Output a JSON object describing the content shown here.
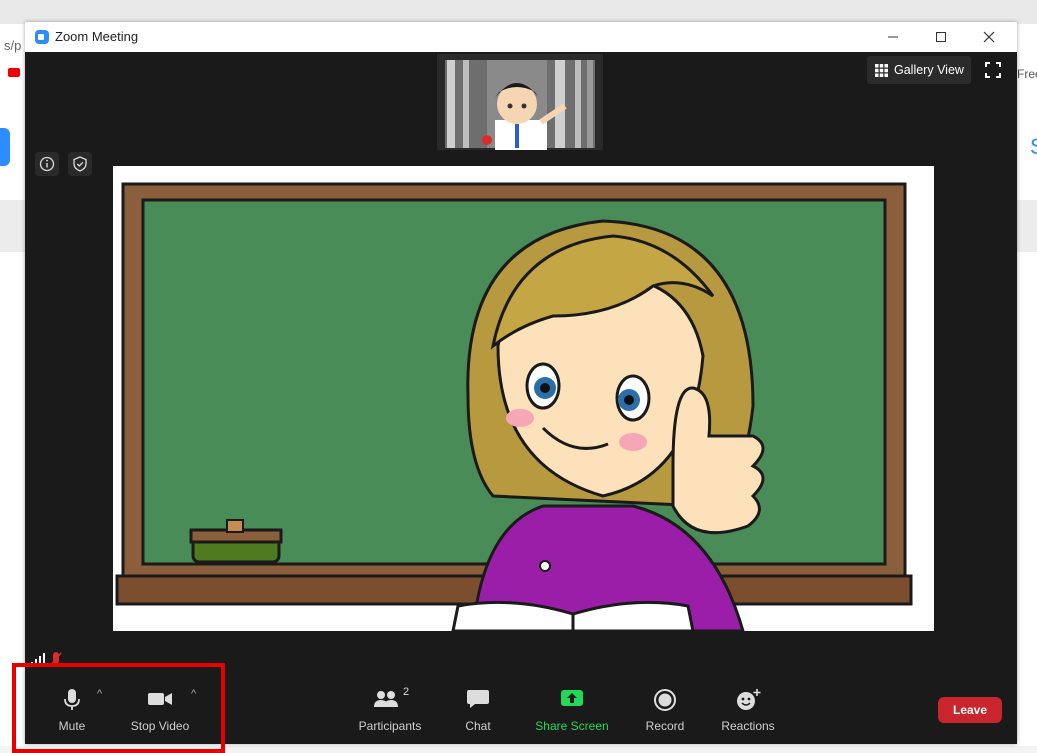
{
  "window": {
    "title": "Zoom Meeting"
  },
  "background": {
    "url_fragment": "s/p",
    "right_text": "Free",
    "right_letter": "S"
  },
  "top_controls": {
    "gallery_view_label": "Gallery View"
  },
  "toolbar": {
    "mute_label": "Mute",
    "stop_video_label": "Stop Video",
    "participants_label": "Participants",
    "participants_count": "2",
    "chat_label": "Chat",
    "share_screen_label": "Share Screen",
    "record_label": "Record",
    "reactions_label": "Reactions",
    "leave_label": "Leave"
  },
  "colors": {
    "accent": "#2d8cff",
    "share_green": "#23d959",
    "leave_red": "#c8252c",
    "highlight_red": "#e80000",
    "chalkboard": "#4a8c58"
  },
  "icons": [
    "zoom-app-icon",
    "minimize-icon",
    "maximize-icon",
    "close-icon",
    "grid-icon",
    "fullscreen-icon",
    "info-icon",
    "shield-icon",
    "signal-icon",
    "mic-icon",
    "video-camera-icon",
    "participants-icon",
    "chat-icon",
    "share-screen-icon",
    "record-icon",
    "reactions-icon"
  ]
}
